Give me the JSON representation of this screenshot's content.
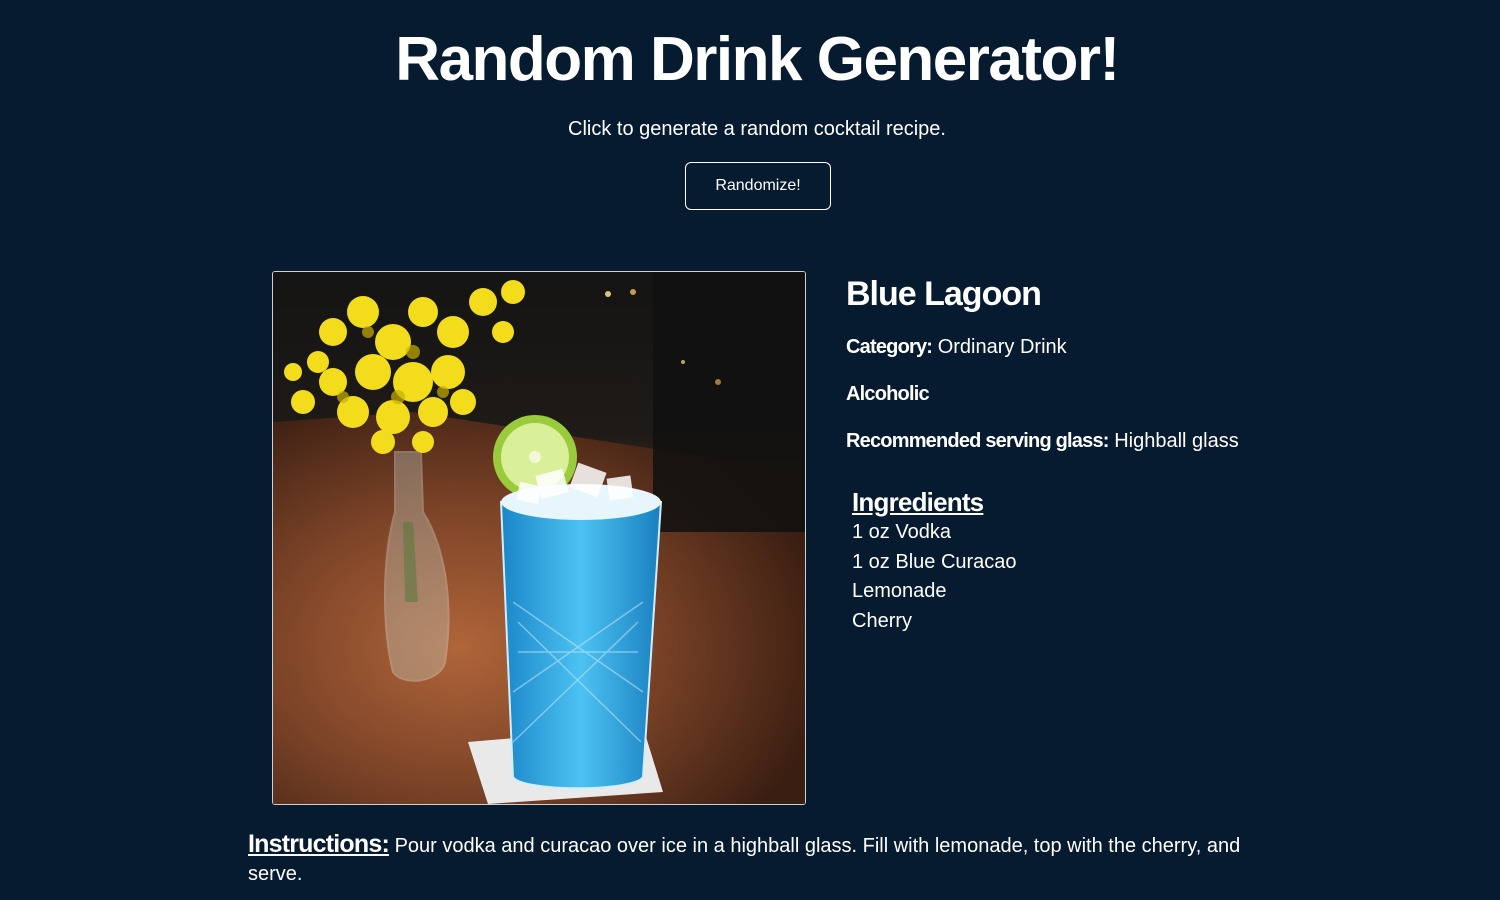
{
  "header": {
    "title": "Random Drink Generator!",
    "subtitle": "Click to generate a random cocktail recipe.",
    "button_label": "Randomize!"
  },
  "drink": {
    "name": "Blue Lagoon",
    "category_label": "Category:",
    "category": "Ordinary Drink",
    "alcoholic": "Alcoholic",
    "glass_label": "Recommended serving glass:",
    "glass": "Highball glass",
    "image_alt": "Blue Lagoon cocktail photo",
    "ingredients_title": "Ingredients",
    "ingredients": [
      "1 oz Vodka",
      "1 oz Blue Curacao",
      "Lemonade",
      "Cherry"
    ],
    "instructions_label": "Instructions:",
    "instructions": "Pour vodka and curacao over ice in a highball glass. Fill with lemonade, top with the cherry, and serve."
  },
  "colors": {
    "background": "#061a30",
    "text": "#ffffff",
    "drink_blue": "#2aa8e6",
    "flower_yellow": "#f2dc1c"
  }
}
